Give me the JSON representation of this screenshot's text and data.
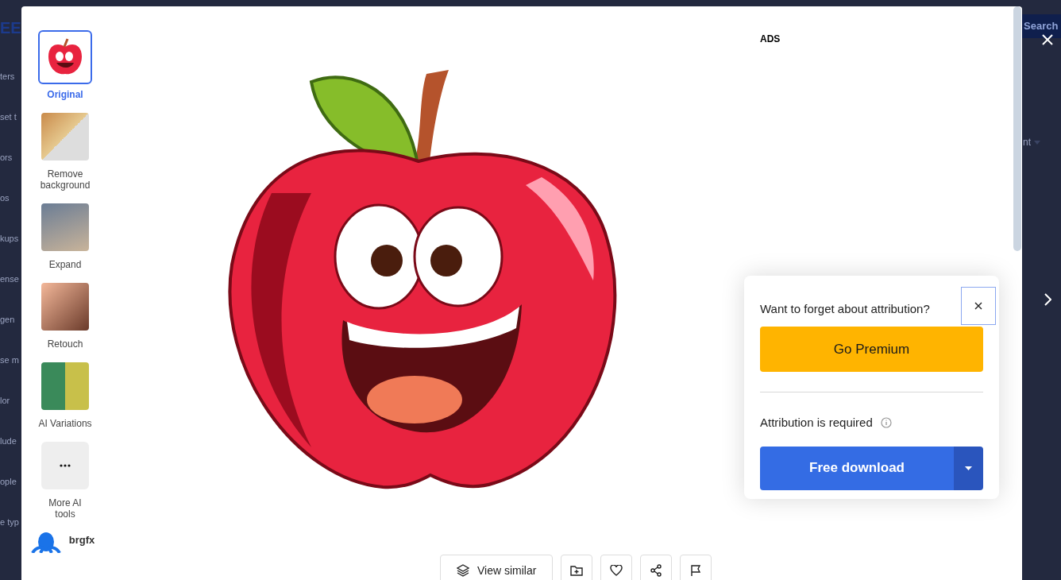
{
  "backdrop": {
    "left_fragments": [
      "EE",
      "ters",
      "set t",
      "ors",
      "os",
      "kups",
      "ense",
      "gen",
      "se m",
      "lor",
      "lude",
      "ople",
      "e typ"
    ],
    "search_button": "Search",
    "sort_fragment": "nt"
  },
  "tools": [
    {
      "kind": "image",
      "label": "Original",
      "selected": true
    },
    {
      "kind": "image",
      "label": "Remove background",
      "selected": false
    },
    {
      "kind": "image",
      "label": "Expand",
      "selected": false
    },
    {
      "kind": "image",
      "label": "Retouch",
      "selected": false
    },
    {
      "kind": "image",
      "label": "AI Variations",
      "selected": false
    },
    {
      "kind": "more",
      "label": "More AI tools",
      "selected": false
    }
  ],
  "author": {
    "name": "brgfx"
  },
  "ads_label": "ADS",
  "attribution_card": {
    "question": "Want to forget about attribution?",
    "premium_button": "Go Premium",
    "required_text": "Attribution is required",
    "download_button": "Free download"
  },
  "actions": {
    "view_similar": "View similar"
  }
}
